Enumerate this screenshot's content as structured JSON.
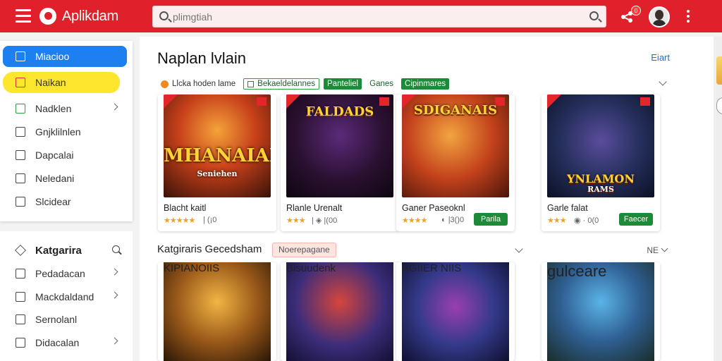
{
  "header": {
    "app_title": "Aplikdam",
    "search_placeholder": "plimgtiah",
    "notification_count": "0"
  },
  "sidebar": {
    "items": [
      {
        "label": "Miacioo",
        "icon": "grid-icon",
        "state": "active-blue",
        "chevron": false
      },
      {
        "label": "Naikan",
        "icon": "x-icon",
        "state": "active-yellow",
        "chevron": false
      },
      {
        "label": "Nadklen",
        "icon": "window-icon",
        "state": "",
        "chevron": true
      },
      {
        "label": "Gnjklilnlen",
        "icon": "window-icon",
        "state": "",
        "chevron": false
      },
      {
        "label": "Dapcalai",
        "icon": "window-icon",
        "state": "",
        "chevron": false
      },
      {
        "label": "Neledani",
        "icon": "window-icon",
        "state": "",
        "chevron": false
      },
      {
        "label": "Slcidear",
        "icon": "home-icon",
        "state": "",
        "chevron": false
      }
    ],
    "categories_title": "Katgarira",
    "category_items": [
      {
        "label": "Pedadacan",
        "chevron": true
      },
      {
        "label": "Mackdaldand",
        "chevron": true
      },
      {
        "label": "Sernolanl",
        "chevron": false
      },
      {
        "label": "Didacalan",
        "chevron": true
      }
    ]
  },
  "main": {
    "title": "Naplan lvlain",
    "see_all": "Eiart",
    "filters": [
      {
        "label": "Llcka hoden lame",
        "style": "plain"
      },
      {
        "label": "Bekaeldelannes",
        "style": "outline"
      },
      {
        "label": "Panteliel",
        "style": "green"
      },
      {
        "label": "Ganes",
        "style": "txt"
      },
      {
        "label": "Cipinmares",
        "style": "green"
      }
    ],
    "cards": [
      {
        "art_title": "MHANAIAIS",
        "art_sub": "Seniehen",
        "name": "Blacht kaitl",
        "stars": "★★★★★",
        "meta": "| (¡0",
        "button": ""
      },
      {
        "art_title": "FALDADS",
        "art_sub": "",
        "name": "Rlanle Urenalt",
        "stars": "★★★",
        "meta": "| ◈ |(00",
        "button": ""
      },
      {
        "art_title": "SDIGANAIS",
        "art_sub": "",
        "name": "Ganer Paseoknl",
        "stars": "★★★★",
        "meta": "◐ |3()0",
        "button": "Parila"
      },
      {
        "art_title": "YNLAMON",
        "art_sub": "RAMS",
        "name": "Garle falat",
        "stars": "★★★",
        "meta": "◉ · 0(0",
        "button": "Faecer"
      }
    ],
    "section2_title": "Katgiraris Gecedsham",
    "section2_chip": "Noerepagane",
    "section2_more": "NE",
    "cards2": [
      {
        "art_title": "KIPIANOIIS"
      },
      {
        "art_title": "Bisuudenk"
      },
      {
        "art_title": "AGIIER NIIS"
      },
      {
        "art_title": "gulceare"
      }
    ]
  },
  "colors": {
    "brand_red": "#e0202a",
    "active_blue": "#1e7ff0",
    "active_yellow": "#ffe62e",
    "action_green": "#1c8a36"
  }
}
